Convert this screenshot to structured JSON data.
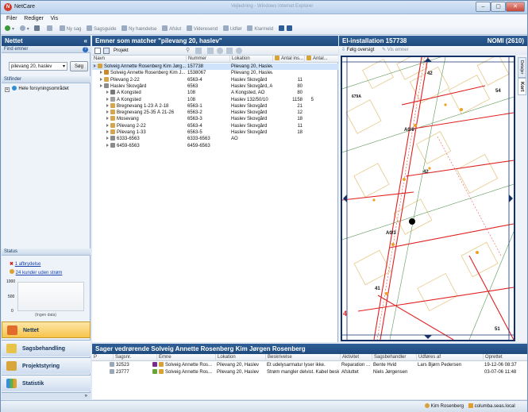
{
  "window": {
    "title": "NetCare",
    "blurred_title": "Vejledning - Windows Internet Explorer"
  },
  "menu": [
    "Filer",
    "Rediger",
    "Vis"
  ],
  "toolbar": [
    "Ny sag",
    "Sagsguide",
    "Ny hændelse",
    "Afslut",
    "Videresend",
    "Udfør",
    "Klarmeld"
  ],
  "left": {
    "title": "Nettet",
    "find_label": "Find emner",
    "search_value": "pilevang 20, haslev",
    "search_button": "Søg",
    "stifinder_label": "Stifinder",
    "tree_root": "Hele forsyningsområdet",
    "status_label": "Status",
    "status_items": [
      "1 afbrydelse",
      "24 kunder uden strøm"
    ],
    "chart_ticks": [
      "1000",
      "500",
      "0"
    ],
    "chart_caption": "(Ingen data)",
    "nav": [
      "Nettet",
      "Sagsbehandling",
      "Projektstyring",
      "Statistik"
    ]
  },
  "center": {
    "title": "Emner som matcher \"pilevang 20, haslev\"",
    "project_label": "Projekt",
    "columns": [
      "Navn",
      "Nummer",
      "Lokation",
      "Antal ins...",
      "Antal..."
    ],
    "rows": [
      {
        "name": "Solveig Annette Rosenberg Kim Jørg...",
        "num": "157738",
        "loc": "Pilevang 20, Haslev",
        "a": "",
        "b": "",
        "indent": 0,
        "sel": true,
        "color": "#d8a13a"
      },
      {
        "name": "Solveig Annette Rosenberg Kim J...",
        "num": "1538067",
        "loc": "Pilevang 20, Haslev",
        "a": "",
        "b": "",
        "indent": 1,
        "color": "#c98a2e"
      },
      {
        "name": "Pilevang 2-22",
        "num": "6563-4",
        "loc": "Haslev Skovgård",
        "a": "11",
        "b": "",
        "indent": 1,
        "color": "#d7a64a"
      },
      {
        "name": "Haslev Skovgård",
        "num": "6563",
        "loc": "Haslev Skovgård, AO",
        "a": "80",
        "b": "",
        "indent": 1,
        "color": "#8b8b8b"
      },
      {
        "name": "A Kongsted",
        "num": "108",
        "loc": "A Kongsted, AO",
        "a": "80",
        "b": "",
        "indent": 2,
        "color": "#7a7a7a"
      },
      {
        "name": "A Kongsted",
        "num": "108",
        "loc": "Haslev 132/50/10",
        "a": "1158",
        "b": "5",
        "indent": 2,
        "color": "#a0a0a0"
      },
      {
        "name": "Bregnevang 1-23 Å 2-18",
        "num": "6563-1",
        "loc": "Haslev Skovgård",
        "a": "21",
        "b": "",
        "indent": 2,
        "color": "#d7a64a"
      },
      {
        "name": "Bregnevang 25-35 Å 21-26",
        "num": "6563-2",
        "loc": "Haslev Skovgård",
        "a": "12",
        "b": "",
        "indent": 2,
        "color": "#d7a64a"
      },
      {
        "name": "Mosevang",
        "num": "6563-3",
        "loc": "Haslev Skovgård",
        "a": "18",
        "b": "",
        "indent": 2,
        "color": "#d7a64a"
      },
      {
        "name": "Pilevang 2-22",
        "num": "6563-4",
        "loc": "Haslev Skovgård",
        "a": "11",
        "b": "",
        "indent": 2,
        "color": "#d7a64a"
      },
      {
        "name": "Pilevang 1-33",
        "num": "6563-5",
        "loc": "Haslev Skovgård",
        "a": "18",
        "b": "",
        "indent": 2,
        "color": "#d7a64a"
      },
      {
        "name": "6333-6563",
        "num": "6333-6563",
        "loc": "AO",
        "a": "",
        "b": "",
        "indent": 2,
        "color": "#8b8b8b"
      },
      {
        "name": "6459-6563",
        "num": "6459-6563",
        "loc": "",
        "a": "",
        "b": "",
        "indent": 2,
        "color": "#8b8b8b"
      }
    ]
  },
  "right": {
    "title": "El-installation 157738",
    "title_right": "NOMI (2610)",
    "follow": "Følg oversigt",
    "show": "Vis emner",
    "side_tabs": [
      "Detaljer",
      "Kort"
    ],
    "map_labels": [
      "42",
      "54",
      "679A",
      "A0/6",
      "42",
      "A0/3",
      "41",
      "51",
      "4"
    ]
  },
  "bottom": {
    "title": "Sager vedrørende Solveig Annette Rosenberg Kim Jørgen Rosenberg",
    "columns": [
      "P",
      "Sagsnr.",
      "Emne",
      "Lokation",
      "Beskrivelse",
      "Aktivitet",
      "Sagsbehandler",
      "Udføres af",
      "Oprettet"
    ],
    "rows": [
      {
        "nr": "32523",
        "emne": "Solveig Annette Ros...",
        "lok": "Pilevang 20, Haslev",
        "besk": "Et udelysarmatur lyser ikke.",
        "akt": "Reparation ...",
        "beh": "Bente Hvid",
        "udf": "Lars Bjørn Pedersen",
        "opr": "19-12-06 08:37",
        "color": "#7a2a8a"
      },
      {
        "nr": "23777",
        "emne": "Solveig Annette Ros...",
        "lok": "Pilevang 20, Haslev",
        "besk": "Strøm mangler delvist. Kabel beska...",
        "akt": "Afsluttet",
        "beh": "Niels Jørgensen",
        "udf": "",
        "opr": "03-07-06 11:48",
        "color": "#6aa23a"
      }
    ]
  },
  "status": {
    "user": "Kim Rosenberg",
    "server": "columba.seas.local"
  }
}
